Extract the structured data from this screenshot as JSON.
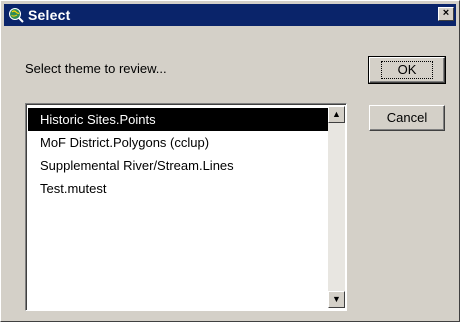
{
  "window": {
    "title": "Select",
    "close_label": "×"
  },
  "dialog": {
    "prompt": "Select theme to review..."
  },
  "list": {
    "items": [
      {
        "label": "Historic Sites.Points",
        "selected": true
      },
      {
        "label": "MoF District.Polygons (cclup)",
        "selected": false
      },
      {
        "label": "Supplemental River/Stream.Lines",
        "selected": false
      },
      {
        "label": "Test.mutest",
        "selected": false
      }
    ],
    "scroll_up_glyph": "▲",
    "scroll_down_glyph": "▼"
  },
  "buttons": {
    "ok_label": "OK",
    "cancel_label": "Cancel"
  },
  "icons": {
    "app_icon": "globe-magnifier-icon"
  },
  "colors": {
    "titlebar": "#0a246a",
    "selection": "#000000",
    "face": "#d4d0c8"
  }
}
